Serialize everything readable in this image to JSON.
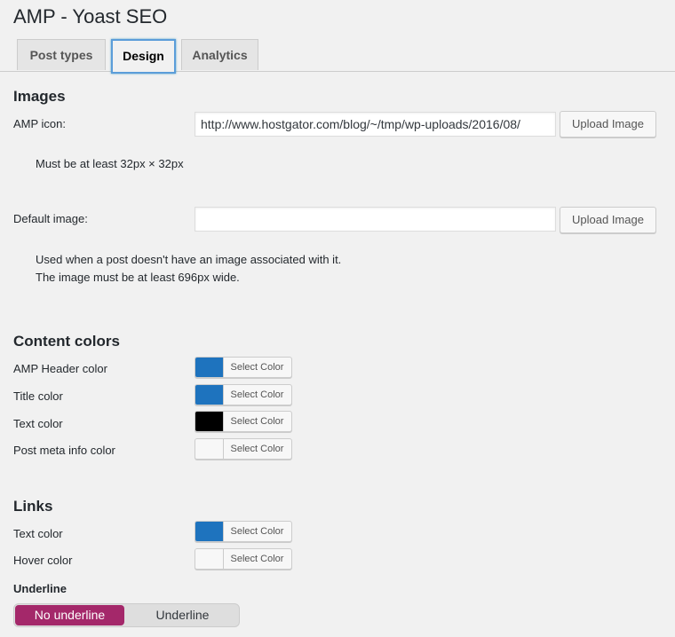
{
  "page": {
    "title": "AMP - Yoast SEO"
  },
  "tabs": [
    {
      "label": "Post types",
      "active": false
    },
    {
      "label": "Design",
      "active": true
    },
    {
      "label": "Analytics",
      "active": false
    }
  ],
  "images": {
    "heading": "Images",
    "amp_icon": {
      "label": "AMP icon:",
      "value": "http://www.hostgator.com/blog/~/tmp/wp-uploads/2016/08/",
      "button": "Upload Image",
      "help": "Must be at least 32px × 32px"
    },
    "default_image": {
      "label": "Default image:",
      "value": "",
      "button": "Upload Image",
      "help_line1": "Used when a post doesn't have an image associated with it.",
      "help_line2": "The image must be at least 696px wide."
    }
  },
  "content_colors": {
    "heading": "Content colors",
    "items": [
      {
        "label": "AMP Header color",
        "button": "Select Color",
        "color": "#1e73be"
      },
      {
        "label": "Title color",
        "button": "Select Color",
        "color": "#1e73be"
      },
      {
        "label": "Text color",
        "button": "Select Color",
        "color": "#000000"
      },
      {
        "label": "Post meta info color",
        "button": "Select Color",
        "color": "#f7f7f7"
      }
    ]
  },
  "links": {
    "heading": "Links",
    "items": [
      {
        "label": "Text color",
        "button": "Select Color",
        "color": "#1e73be"
      },
      {
        "label": "Hover color",
        "button": "Select Color",
        "color": "#f7f7f7"
      }
    ],
    "underline": {
      "label": "Underline",
      "options": [
        "No underline",
        "Underline"
      ],
      "selected": "No underline",
      "accent_color": "#a4286a"
    }
  }
}
